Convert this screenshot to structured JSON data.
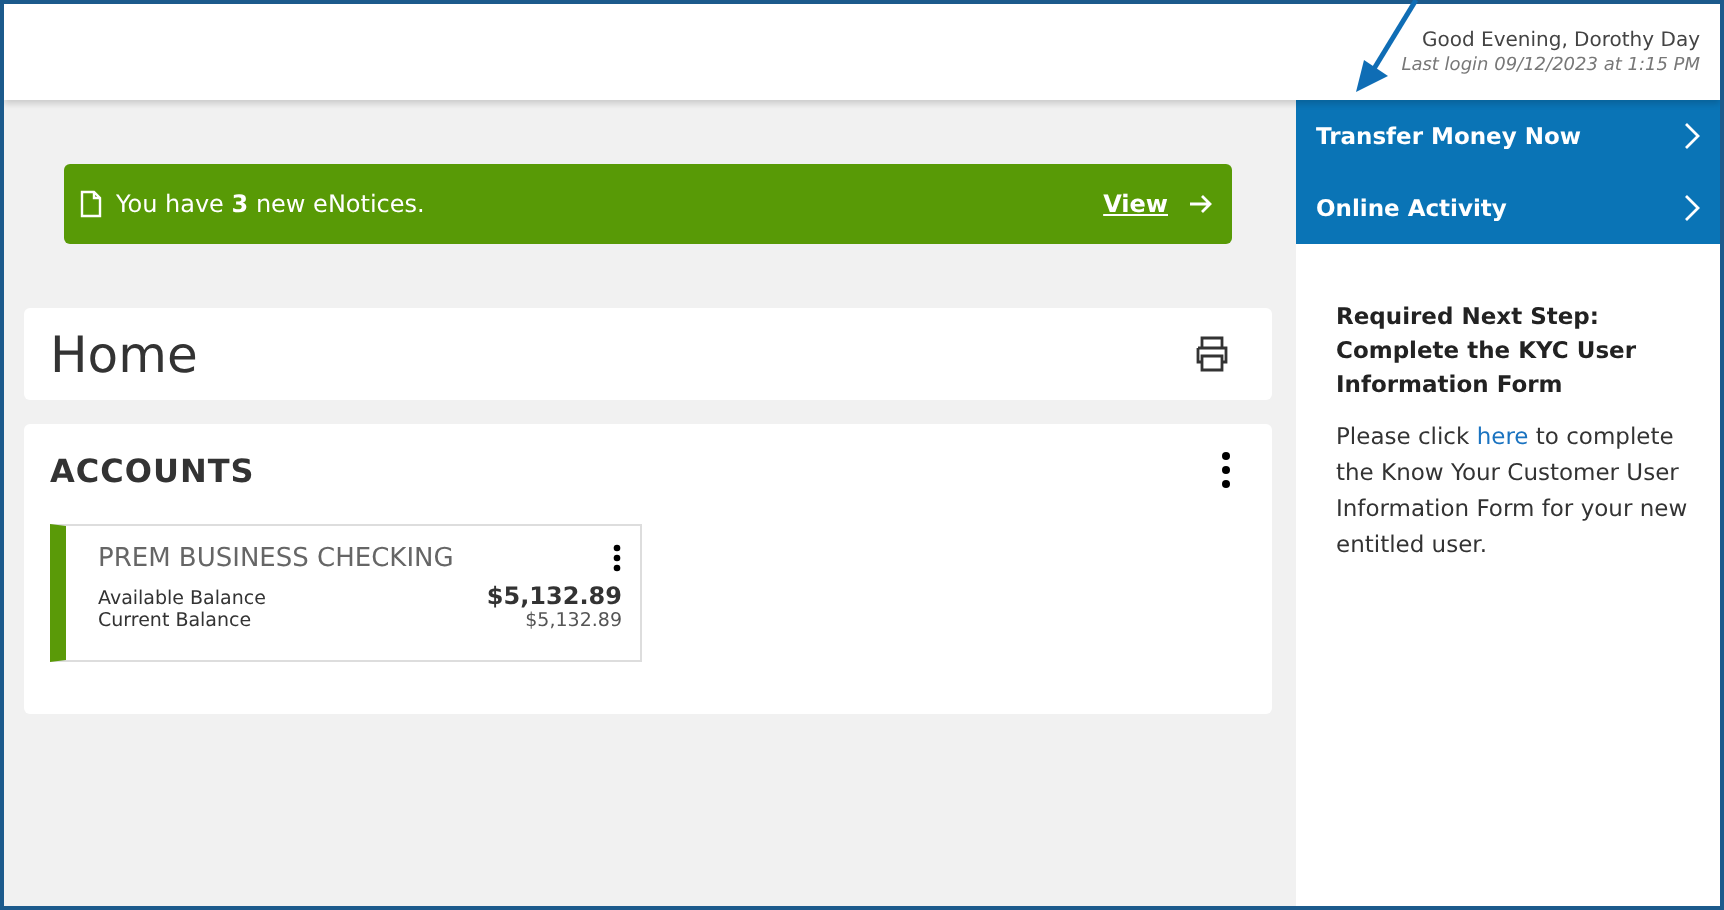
{
  "header": {
    "greeting": "Good Evening, Dorothy Day",
    "last_login": "Last login 09/12/2023 at 1:15 PM"
  },
  "notice": {
    "before": "You have ",
    "count": "3",
    "after": " new eNotices.",
    "link": "View"
  },
  "page_title": "Home",
  "accounts": {
    "title": "ACCOUNTS",
    "items": [
      {
        "name": "PREM BUSINESS CHECKING",
        "color": "#5a9a08",
        "rows": [
          {
            "label": "Available Balance",
            "value": "$5,132.89",
            "kind": "primary"
          },
          {
            "label": "Current Balance",
            "value": "$5,132.89",
            "kind": "secondary"
          }
        ]
      }
    ]
  },
  "quick_links": [
    {
      "label": "Transfer Money Now"
    },
    {
      "label": "Online Activity"
    }
  ],
  "next_step": {
    "title": "Required Next Step: Complete the KYC User Information Form",
    "text_before": "Please click ",
    "link": "here",
    "text_after": " to complete the Know Your Customer User Information Form for your new entitled user."
  }
}
